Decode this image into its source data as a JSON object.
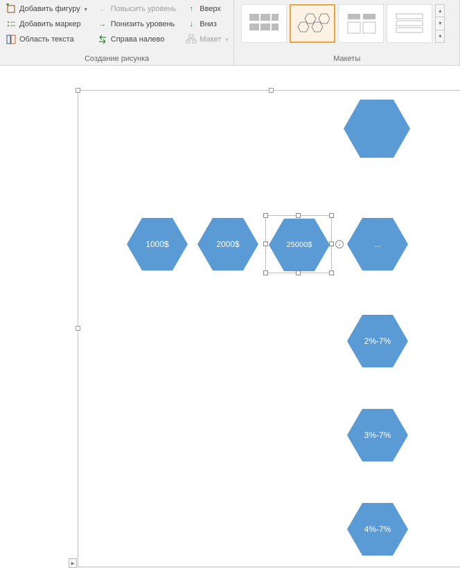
{
  "ribbon": {
    "group_drawing": {
      "label": "Создание рисунка",
      "add_shape": "Добавить фигуру",
      "add_bullet": "Добавить маркер",
      "text_pane": "Область текста",
      "promote": "Повысить уровень",
      "demote": "Понизить уровень",
      "rtl": "Справа налево",
      "up": "Вверх",
      "down": "Вниз",
      "layout": "Макет"
    },
    "group_layouts": {
      "label": "Макеты"
    }
  },
  "shapes": {
    "hex_row": [
      "1000$",
      "2000$",
      "25000$",
      "..."
    ],
    "hex_col": [
      "2%-7%",
      "3%-7%",
      "4%-7%"
    ]
  }
}
